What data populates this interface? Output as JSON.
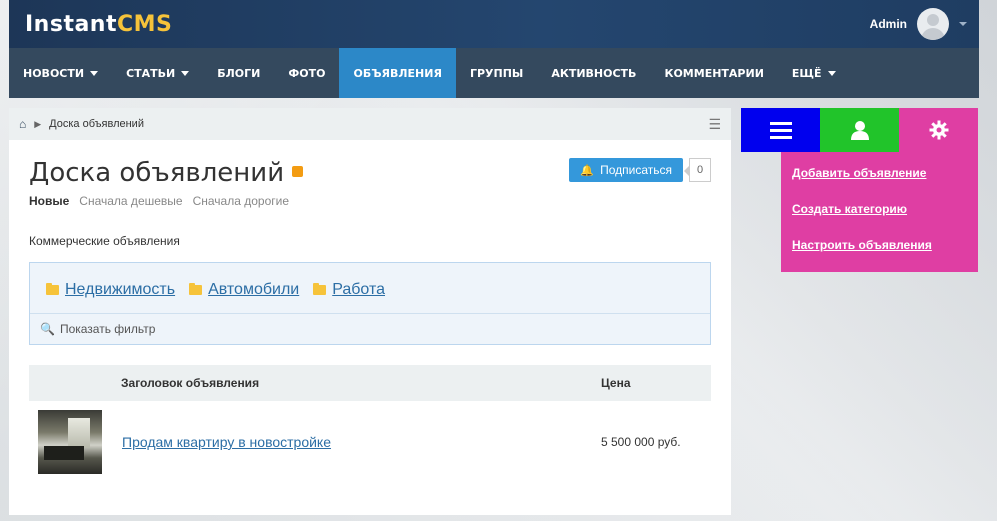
{
  "header": {
    "logo_part1": "Instant",
    "logo_part2": "CMS",
    "user_name": "Admin"
  },
  "nav": {
    "items": [
      {
        "label": "НОВОСТИ",
        "dropdown": true
      },
      {
        "label": "СТАТЬИ",
        "dropdown": true
      },
      {
        "label": "БЛОГИ",
        "dropdown": false
      },
      {
        "label": "ФОТО",
        "dropdown": false
      },
      {
        "label": "ОБЪЯВЛЕНИЯ",
        "dropdown": false,
        "active": true
      },
      {
        "label": "ГРУППЫ",
        "dropdown": false
      },
      {
        "label": "АКТИВНОСТЬ",
        "dropdown": false
      },
      {
        "label": "КОММЕНТАРИИ",
        "dropdown": false
      },
      {
        "label": "ЕЩЁ",
        "dropdown": true
      }
    ]
  },
  "breadcrumb": {
    "current": "Доска объявлений"
  },
  "page": {
    "title": "Доска объявлений",
    "subscribe_label": "Подписаться",
    "subscribe_count": "0",
    "sorts": [
      "Новые",
      "Сначала дешевые",
      "Сначала дорогие"
    ],
    "section_label": "Коммерческие объявления",
    "categories": [
      "Недвижимость",
      "Автомобили",
      "Работа"
    ],
    "filter_label": "Показать фильтр"
  },
  "table": {
    "col_title": "Заголовок объявления",
    "col_price": "Цена",
    "rows": [
      {
        "title": "Продам квартиру в новостройке",
        "price": "5 500 000 руб."
      }
    ]
  },
  "sidebar": {
    "links": [
      "Добавить объявление",
      "Создать категорию",
      "Настроить объявления"
    ]
  },
  "colors": {
    "topbar": "#1d3657",
    "nav": "#34495e",
    "nav_active": "#2c88c8",
    "tab_blue": "#0000ee",
    "tab_green": "#21c42a",
    "tab_pink": "#df3ea3"
  }
}
